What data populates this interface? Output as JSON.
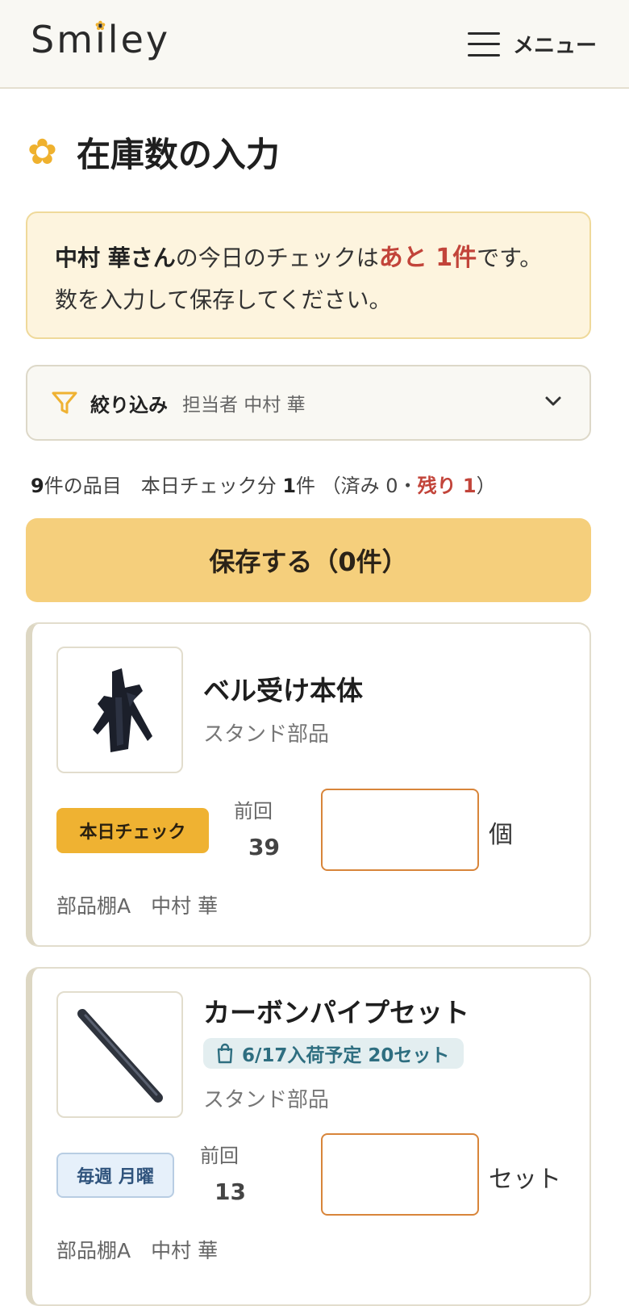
{
  "header": {
    "logo_before": "Sm",
    "logo_i": "i",
    "logo_after": "ley",
    "menu_label": "メニュー"
  },
  "page": {
    "title": "在庫数の入力"
  },
  "notice": {
    "name": "中村 華さん",
    "text1": "の今日のチェックは",
    "remaining": "あと 1件",
    "text2": "です。数を入力して保存してください。"
  },
  "filter": {
    "label": "絞り込み",
    "value": "担当者 中村 華"
  },
  "summary": {
    "item_count": "9",
    "items_label": "件の品目　本日チェック分 ",
    "today_count": "1",
    "today_label": "件 （済み 0・",
    "remaining": "残り 1",
    "close": "）"
  },
  "save_button": {
    "label": "保存する（0件）"
  },
  "products": [
    {
      "name": "ベル受け本体",
      "category": "スタンド部品",
      "badge": "本日チェック",
      "prev_label": "前回",
      "prev_value": "39",
      "input_value": "",
      "unit": "個",
      "location": "部品棚A",
      "person": "中村 華"
    },
    {
      "name": "カーボンパイプセット",
      "arrival": "6/17入荷予定 20セット",
      "category": "スタンド部品",
      "badge": "毎週 月曜",
      "prev_label": "前回",
      "prev_value": "13",
      "input_value": "",
      "unit": "セット",
      "location": "部品棚A",
      "person": "中村 華"
    }
  ],
  "colors": {
    "accent": "#efb232",
    "save_button": "#f5cf7c",
    "alert": "#c2443a",
    "input_border": "#d8853a",
    "arrival_text": "#2e6e80"
  }
}
